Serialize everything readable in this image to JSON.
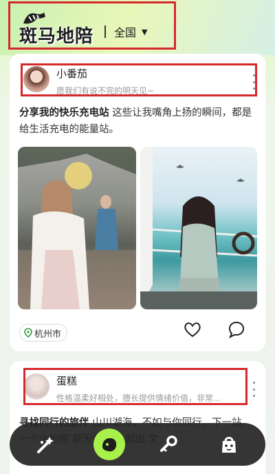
{
  "header": {
    "logo_text": "斑马地陪",
    "region": "全国"
  },
  "posts": [
    {
      "user": {
        "name": "小番茄",
        "signature": "愿我们有说不完的明天见~"
      },
      "title": "分享我的快乐充电站",
      "body": " 这些让我嘴角上扬的瞬间，都是给生活充电的能量站。",
      "location": "杭州市"
    },
    {
      "user": {
        "name": "蛋糕",
        "signature": "性格温柔好相处，擅长提供情绪价值，非常..."
      },
      "title": "寻找同行的旅伴",
      "body": " 山川湖海，不如与你同行。下一站，一个会拍照 聊天的 要一起出 文"
    }
  ],
  "colors": {
    "highlight_box": "#d6272b",
    "nav_active": "#a8f04a",
    "nav_bg": "#242424",
    "header_bg": "#c8f0b0"
  },
  "icons": {
    "nav": [
      "wand-icon",
      "home-blob-icon",
      "chat-key-icon",
      "bag-face-icon"
    ],
    "actions": [
      "heart-icon",
      "comment-icon"
    ],
    "location": "location-pin-icon",
    "region": "caret-down-icon"
  },
  "nav_active_index": 1
}
